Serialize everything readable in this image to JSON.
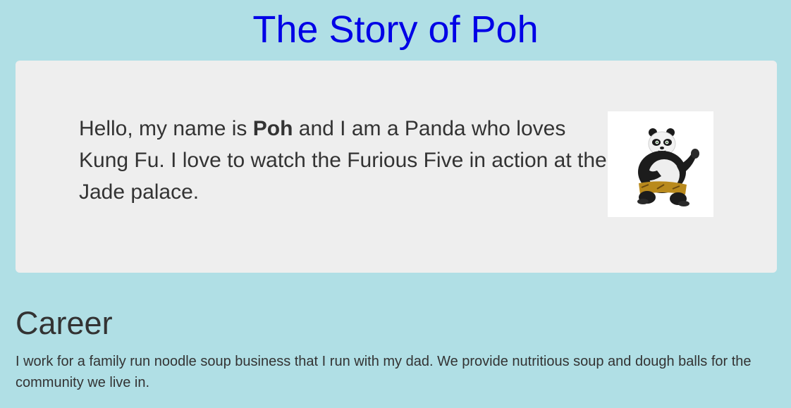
{
  "page": {
    "title": "The Story of Poh",
    "title_color": "#0000e6",
    "background_color": "#b0dfe5"
  },
  "intro": {
    "text_before": "Hello, my name is ",
    "name": "Poh",
    "text_after": " and I am a Panda who loves Kung Fu. I love to watch the Furious Five in action at the Jade palace.",
    "image_icon": "panda-kung-fu-image"
  },
  "career": {
    "heading": "Career",
    "body": "I work for a family run noodle soup business that I run with my dad. We provide nutritious soup and dough balls for the community we live in."
  }
}
